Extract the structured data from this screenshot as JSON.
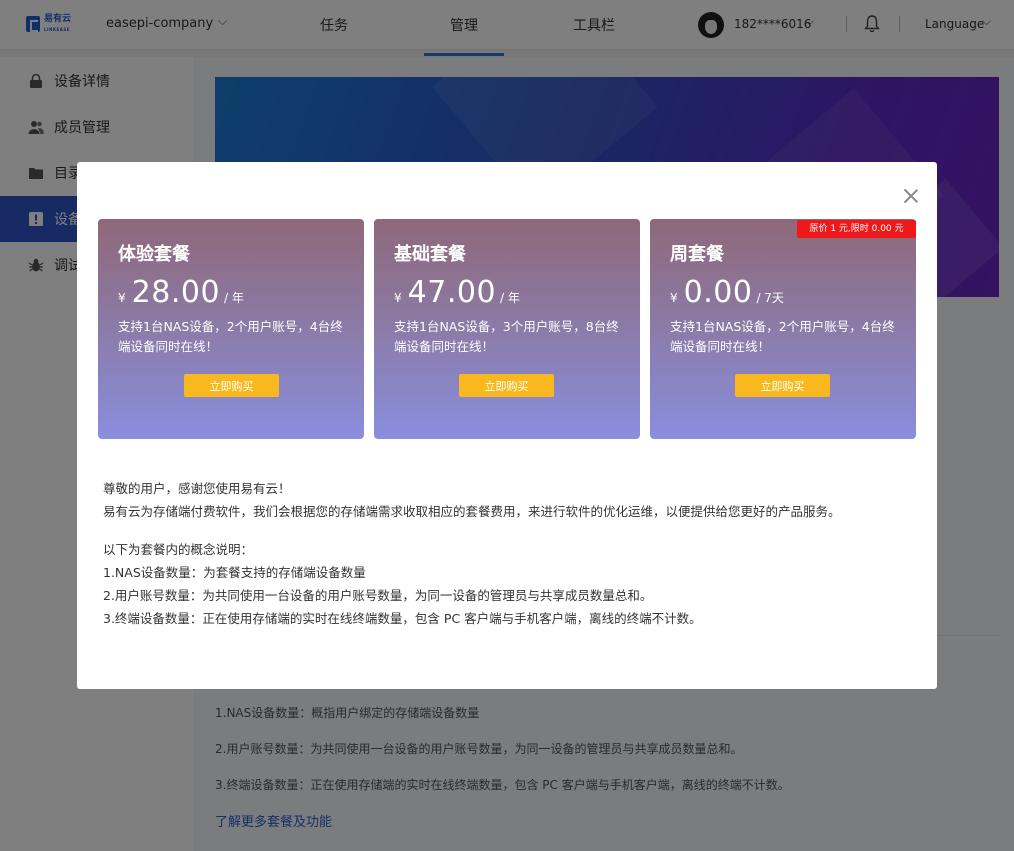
{
  "header": {
    "logo_text": "易有云",
    "logo_sub": "LINKEASE",
    "company": "easepi-company",
    "tabs": [
      "任务",
      "管理",
      "工具栏"
    ],
    "active_tab": "管理",
    "user": "182****6016",
    "language": "Language"
  },
  "sidebar": {
    "items": [
      {
        "label": "设备详情",
        "icon": "lock-icon"
      },
      {
        "label": "成员管理",
        "icon": "users-icon"
      },
      {
        "label": "目录",
        "icon": "folder-icon"
      },
      {
        "label": "设备",
        "icon": "info-icon"
      },
      {
        "label": "调试",
        "icon": "bug-icon"
      }
    ],
    "active_index": 3
  },
  "background": {
    "lines": [
      "1.NAS设备数量：概指用户绑定的存储端设备数量",
      "2.用户账号数量：为共同使用一台设备的用户账号数量，为同一设备的管理员与共享成员数量总和。",
      "3.终端设备数量：正在使用存储端的实时在线终端数量，包含 PC 客户端与手机客户端，离线的终端不计数。"
    ],
    "link": "了解更多套餐及功能"
  },
  "modal": {
    "plans": [
      {
        "title": "体验套餐",
        "currency": "¥",
        "price": "28.00",
        "unit": "/ 年",
        "desc": "支持1台NAS设备，2个用户账号，4台终端设备同时在线！",
        "button": "立即购买",
        "badge": ""
      },
      {
        "title": "基础套餐",
        "currency": "¥",
        "price": "47.00",
        "unit": "/ 年",
        "desc": "支持1台NAS设备，3个用户账号，8台终端设备同时在线！",
        "button": "立即购买",
        "badge": ""
      },
      {
        "title": "周套餐",
        "currency": "¥",
        "price": "0.00",
        "unit": "/ 7天",
        "desc": "支持1台NAS设备，2个用户账号，4台终端设备同时在线！",
        "button": "立即购买",
        "badge": "原价 1 元,限时 0.00 元"
      }
    ],
    "greeting": "尊敬的用户，感谢您使用易有云！",
    "intro": "易有云为存储端付费软件，我们会根据您的存储端需求收取相应的套餐费用，来进行软件的优化运维，以便提供给您更好的产品服务。",
    "concept_title": "以下为套餐内的概念说明：",
    "concepts": [
      "1.NAS设备数量：为套餐支持的存储端设备数量",
      "2.用户账号数量：为共同使用一台设备的用户账号数量，为同一设备的管理员与共享成员数量总和。",
      "3.终端设备数量：正在使用存储端的实时在线终端数量，包含 PC 客户端与手机客户端，离线的终端不计数。"
    ]
  }
}
